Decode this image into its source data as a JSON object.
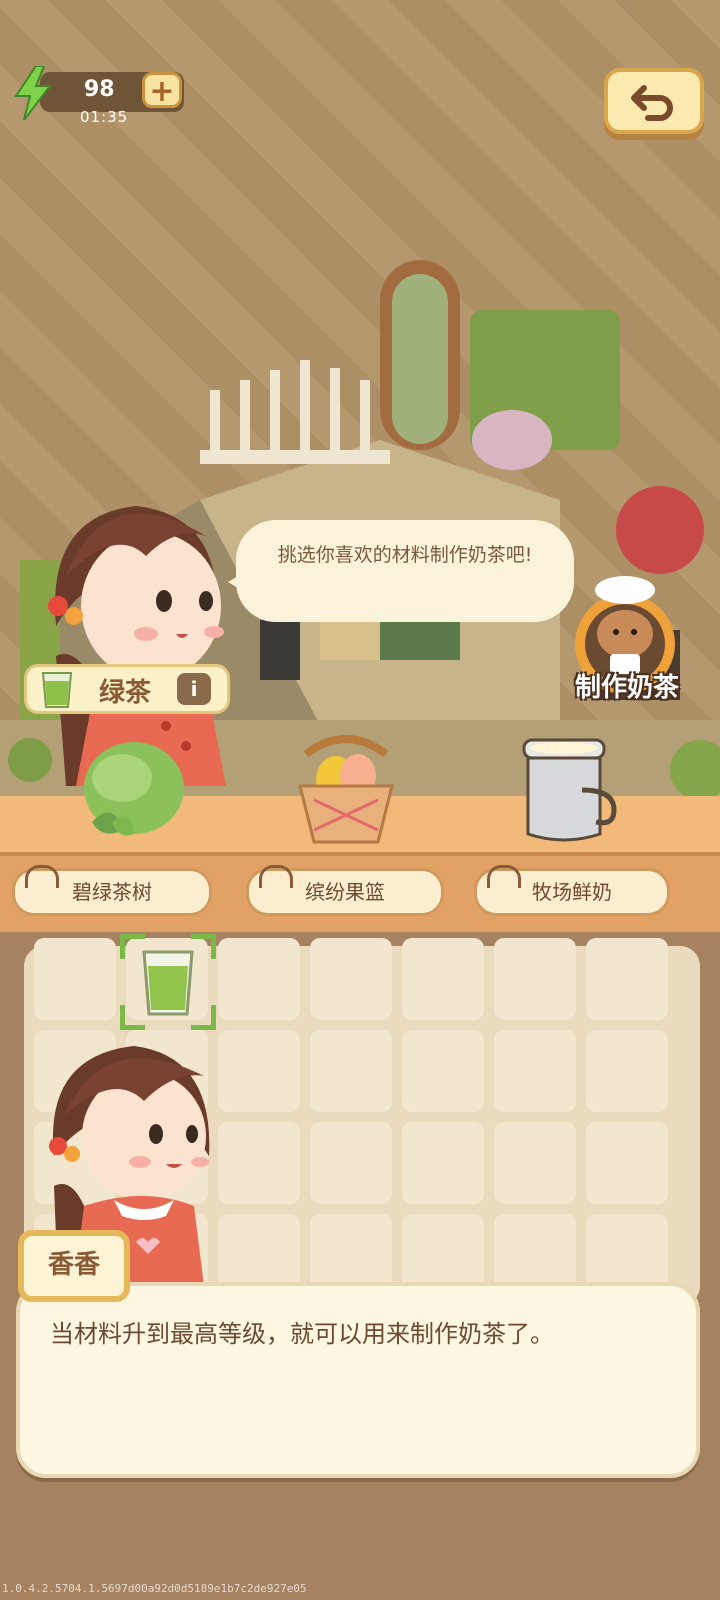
{
  "energy": {
    "value": "98",
    "timer": "01:35",
    "add_label": "+"
  },
  "bubble": {
    "text": "挑选你喜欢的材料制作奶茶吧!"
  },
  "make_tea": {
    "label": "制作奶茶"
  },
  "ingredient_tag": {
    "label": "绿茶",
    "info": "i"
  },
  "sources": [
    {
      "label": "碧绿茶树"
    },
    {
      "label": "缤纷果篮"
    },
    {
      "label": "牧场鲜奶"
    }
  ],
  "dialog": {
    "speaker": "香香",
    "text": "当材料升到最高等级，就可以用来制作奶茶了。"
  },
  "footer": {
    "build": "1.0.4.2.5704.1.5697d00a92d0d5189e1b7c2de927e05"
  },
  "colors": {
    "accent": "#e7b85a",
    "text": "#6b4a32",
    "green": "#7bb84a"
  }
}
